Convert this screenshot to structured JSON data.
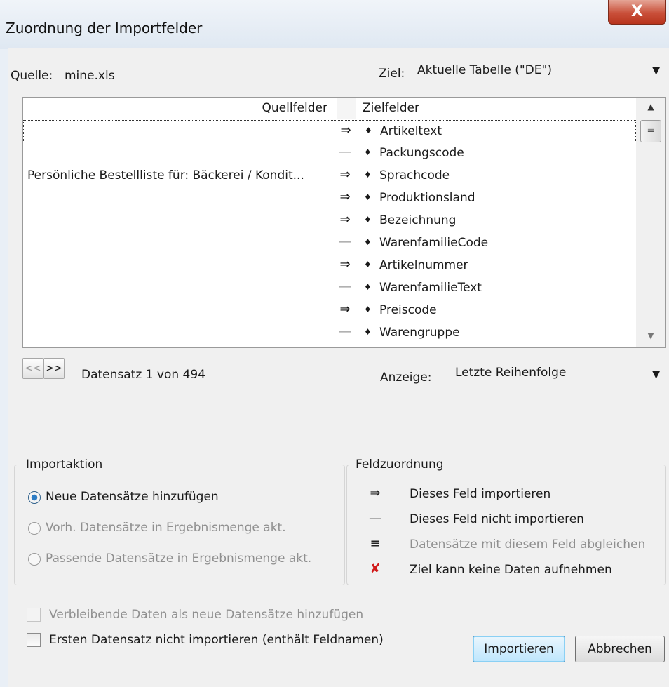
{
  "window": {
    "title": "Zuordnung der Importfelder",
    "close_label": "X"
  },
  "source": {
    "label": "Quelle:",
    "file": "mine.xls"
  },
  "target": {
    "label": "Ziel:",
    "value": "Aktuelle Tabelle (\"DE\")"
  },
  "grid": {
    "col_source": "Quellfelder",
    "col_target": "Zielfelder",
    "rows": [
      {
        "source": "",
        "op": "⇒",
        "target": "Artikeltext",
        "selected": true
      },
      {
        "source": "",
        "op": "—",
        "target": "Packungscode"
      },
      {
        "source": "Persönliche Bestellliste für: Bäckerei / Kondit...",
        "op": "⇒",
        "target": "Sprachcode"
      },
      {
        "source": "",
        "op": "⇒",
        "target": "Produktionsland"
      },
      {
        "source": "",
        "op": "⇒",
        "target": "Bezeichnung"
      },
      {
        "source": "",
        "op": "—",
        "target": "WarenfamilieCode"
      },
      {
        "source": "",
        "op": "⇒",
        "target": "Artikelnummer"
      },
      {
        "source": "",
        "op": "—",
        "target": "WarenfamilieText"
      },
      {
        "source": "",
        "op": "⇒",
        "target": "Preiscode"
      },
      {
        "source": "",
        "op": "—",
        "target": "Warengruppe"
      }
    ]
  },
  "navigation": {
    "prev_label": "<<",
    "next_label": ">>",
    "record_text": "Datensatz 1 von 494"
  },
  "display": {
    "label": "Anzeige:",
    "value": "Letzte Reihenfolge"
  },
  "import_action": {
    "title": "Importaktion",
    "options": [
      {
        "label": "Neue Datensätze hinzufügen",
        "checked": true,
        "enabled": true
      },
      {
        "label": "Vorh. Datensätze in Ergebnismenge akt.",
        "checked": false,
        "enabled": false
      },
      {
        "label": "Passende Datensätze in Ergebnismenge akt.",
        "checked": false,
        "enabled": false
      }
    ]
  },
  "field_mapping": {
    "title": "Feldzuordnung",
    "items": [
      {
        "icon": "⇒",
        "icon_name": "import-arrow-icon",
        "label": "Dieses Feld importieren",
        "enabled": true
      },
      {
        "icon": "—",
        "icon_name": "dash-icon",
        "label": "Dieses Feld nicht importieren",
        "enabled": true
      },
      {
        "icon": "≡",
        "icon_name": "equals-icon",
        "label": "Datensätze mit diesem Feld abgleichen",
        "enabled": false
      },
      {
        "icon": "✘",
        "icon_name": "cross-icon",
        "label": "Ziel kann keine Daten aufnehmen",
        "enabled": true
      }
    ]
  },
  "options": {
    "remaining_data": "Verbleibende Daten als neue Datensätze hinzufügen",
    "skip_first": "Ersten Datensatz nicht importieren (enthält Feldnamen)"
  },
  "buttons": {
    "import": "Importieren",
    "cancel": "Abbrechen"
  },
  "colors": {
    "accent": "#2c7cc5",
    "close_red": "#c9503a",
    "error_red": "#d11a1a"
  }
}
